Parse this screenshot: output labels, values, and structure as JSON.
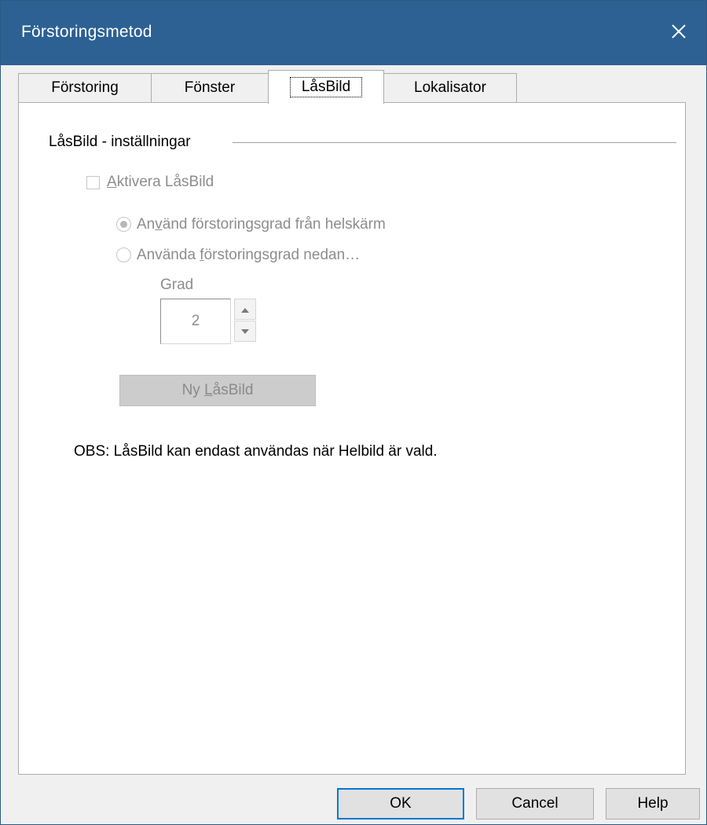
{
  "window": {
    "title": "Förstoringsmetod",
    "close_icon": "close-icon"
  },
  "tabs": [
    {
      "label": "Förstoring",
      "active": false
    },
    {
      "label": "Fönster",
      "active": false
    },
    {
      "label": "LåsBild",
      "active": true
    },
    {
      "label": "Lokalisator",
      "active": false
    }
  ],
  "panel": {
    "group_title": "LåsBild - inställningar",
    "enable_checkbox": {
      "label_pre": "",
      "label_accel": "A",
      "label_post": "ktivera LåsBild",
      "checked": false,
      "enabled": false
    },
    "radio_fullscreen": {
      "label_pre": "An",
      "label_accel": "v",
      "label_post": "änd förstoringsgrad från helskärm",
      "checked": true,
      "enabled": false
    },
    "radio_custom": {
      "label_pre": "Använda ",
      "label_accel": "f",
      "label_post": "örstoringsgrad nedan…",
      "checked": false,
      "enabled": false
    },
    "grade_label": "Grad",
    "grade_value": "2",
    "new_lock_button": {
      "label_pre": "Ny ",
      "label_accel": "L",
      "label_post": "åsBild",
      "enabled": false
    },
    "note": "OBS: LåsBild kan endast användas när Helbild är vald."
  },
  "footer": {
    "ok": "OK",
    "cancel": "Cancel",
    "help": "Help"
  }
}
